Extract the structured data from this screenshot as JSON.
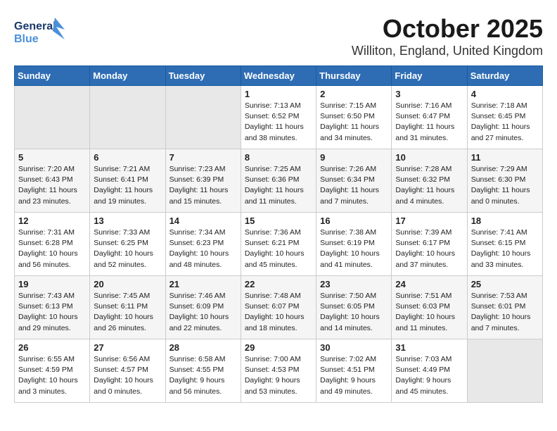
{
  "header": {
    "logo_line1": "General",
    "logo_line2": "Blue",
    "month": "October 2025",
    "location": "Williton, England, United Kingdom"
  },
  "weekdays": [
    "Sunday",
    "Monday",
    "Tuesday",
    "Wednesday",
    "Thursday",
    "Friday",
    "Saturday"
  ],
  "weeks": [
    [
      {
        "day": "",
        "empty": true
      },
      {
        "day": "",
        "empty": true
      },
      {
        "day": "",
        "empty": true
      },
      {
        "day": "1",
        "sunrise": "7:13 AM",
        "sunset": "6:52 PM",
        "daylight": "11 hours and 38 minutes."
      },
      {
        "day": "2",
        "sunrise": "7:15 AM",
        "sunset": "6:50 PM",
        "daylight": "11 hours and 34 minutes."
      },
      {
        "day": "3",
        "sunrise": "7:16 AM",
        "sunset": "6:47 PM",
        "daylight": "11 hours and 31 minutes."
      },
      {
        "day": "4",
        "sunrise": "7:18 AM",
        "sunset": "6:45 PM",
        "daylight": "11 hours and 27 minutes."
      }
    ],
    [
      {
        "day": "5",
        "sunrise": "7:20 AM",
        "sunset": "6:43 PM",
        "daylight": "11 hours and 23 minutes."
      },
      {
        "day": "6",
        "sunrise": "7:21 AM",
        "sunset": "6:41 PM",
        "daylight": "11 hours and 19 minutes."
      },
      {
        "day": "7",
        "sunrise": "7:23 AM",
        "sunset": "6:39 PM",
        "daylight": "11 hours and 15 minutes."
      },
      {
        "day": "8",
        "sunrise": "7:25 AM",
        "sunset": "6:36 PM",
        "daylight": "11 hours and 11 minutes."
      },
      {
        "day": "9",
        "sunrise": "7:26 AM",
        "sunset": "6:34 PM",
        "daylight": "11 hours and 7 minutes."
      },
      {
        "day": "10",
        "sunrise": "7:28 AM",
        "sunset": "6:32 PM",
        "daylight": "11 hours and 4 minutes."
      },
      {
        "day": "11",
        "sunrise": "7:29 AM",
        "sunset": "6:30 PM",
        "daylight": "11 hours and 0 minutes."
      }
    ],
    [
      {
        "day": "12",
        "sunrise": "7:31 AM",
        "sunset": "6:28 PM",
        "daylight": "10 hours and 56 minutes."
      },
      {
        "day": "13",
        "sunrise": "7:33 AM",
        "sunset": "6:25 PM",
        "daylight": "10 hours and 52 minutes."
      },
      {
        "day": "14",
        "sunrise": "7:34 AM",
        "sunset": "6:23 PM",
        "daylight": "10 hours and 48 minutes."
      },
      {
        "day": "15",
        "sunrise": "7:36 AM",
        "sunset": "6:21 PM",
        "daylight": "10 hours and 45 minutes."
      },
      {
        "day": "16",
        "sunrise": "7:38 AM",
        "sunset": "6:19 PM",
        "daylight": "10 hours and 41 minutes."
      },
      {
        "day": "17",
        "sunrise": "7:39 AM",
        "sunset": "6:17 PM",
        "daylight": "10 hours and 37 minutes."
      },
      {
        "day": "18",
        "sunrise": "7:41 AM",
        "sunset": "6:15 PM",
        "daylight": "10 hours and 33 minutes."
      }
    ],
    [
      {
        "day": "19",
        "sunrise": "7:43 AM",
        "sunset": "6:13 PM",
        "daylight": "10 hours and 29 minutes."
      },
      {
        "day": "20",
        "sunrise": "7:45 AM",
        "sunset": "6:11 PM",
        "daylight": "10 hours and 26 minutes."
      },
      {
        "day": "21",
        "sunrise": "7:46 AM",
        "sunset": "6:09 PM",
        "daylight": "10 hours and 22 minutes."
      },
      {
        "day": "22",
        "sunrise": "7:48 AM",
        "sunset": "6:07 PM",
        "daylight": "10 hours and 18 minutes."
      },
      {
        "day": "23",
        "sunrise": "7:50 AM",
        "sunset": "6:05 PM",
        "daylight": "10 hours and 14 minutes."
      },
      {
        "day": "24",
        "sunrise": "7:51 AM",
        "sunset": "6:03 PM",
        "daylight": "10 hours and 11 minutes."
      },
      {
        "day": "25",
        "sunrise": "7:53 AM",
        "sunset": "6:01 PM",
        "daylight": "10 hours and 7 minutes."
      }
    ],
    [
      {
        "day": "26",
        "sunrise": "6:55 AM",
        "sunset": "4:59 PM",
        "daylight": "10 hours and 3 minutes."
      },
      {
        "day": "27",
        "sunrise": "6:56 AM",
        "sunset": "4:57 PM",
        "daylight": "10 hours and 0 minutes."
      },
      {
        "day": "28",
        "sunrise": "6:58 AM",
        "sunset": "4:55 PM",
        "daylight": "9 hours and 56 minutes."
      },
      {
        "day": "29",
        "sunrise": "7:00 AM",
        "sunset": "4:53 PM",
        "daylight": "9 hours and 53 minutes."
      },
      {
        "day": "30",
        "sunrise": "7:02 AM",
        "sunset": "4:51 PM",
        "daylight": "9 hours and 49 minutes."
      },
      {
        "day": "31",
        "sunrise": "7:03 AM",
        "sunset": "4:49 PM",
        "daylight": "9 hours and 45 minutes."
      },
      {
        "day": "",
        "empty": true
      }
    ]
  ]
}
